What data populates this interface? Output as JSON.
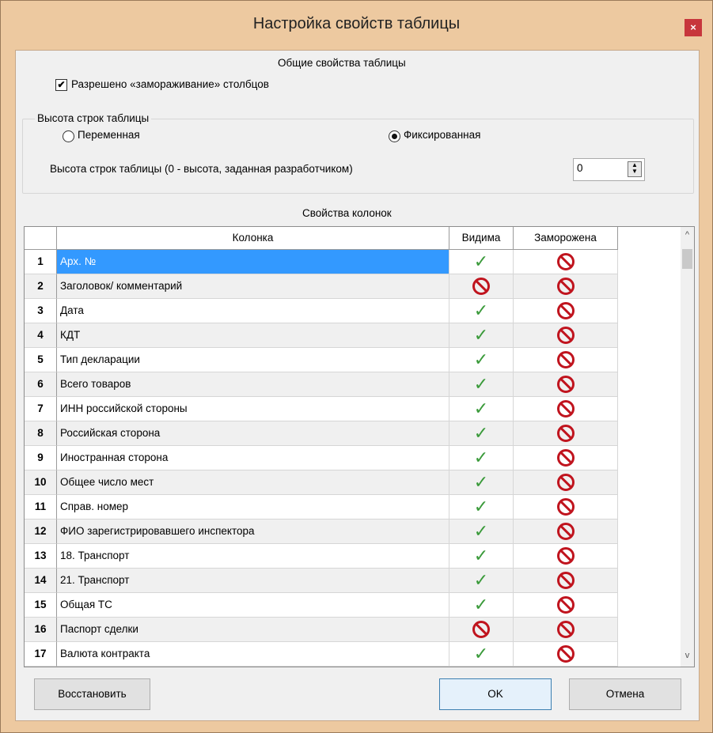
{
  "window": {
    "title": "Настройка свойств таблицы",
    "close_label": "×"
  },
  "general": {
    "heading": "Общие свойства таблицы",
    "freeze_checkbox": {
      "label": "Разрешено «замораживание» столбцов",
      "checked": true,
      "mark": "✔"
    }
  },
  "row_height": {
    "legend": "Высота строк таблицы",
    "variable_label": "Переменная",
    "fixed_label": "Фиксированная",
    "selected": "fixed",
    "height_label": "Высота строк таблицы (0 - высота, заданная разработчиком)",
    "height_value": "0",
    "spin_up": "▲",
    "spin_down": "▼"
  },
  "columns": {
    "heading": "Свойства колонок",
    "headers": {
      "column": "Колонка",
      "visible": "Видима",
      "frozen": "Заморожена"
    },
    "rows": [
      {
        "num": "1",
        "name": "Арх. №",
        "visible": true,
        "frozen": false,
        "selected": true
      },
      {
        "num": "2",
        "name": "Заголовок/ комментарий",
        "visible": false,
        "frozen": false
      },
      {
        "num": "3",
        "name": "Дата",
        "visible": true,
        "frozen": false
      },
      {
        "num": "4",
        "name": "КДТ",
        "visible": true,
        "frozen": false
      },
      {
        "num": "5",
        "name": "Тип декларации",
        "visible": true,
        "frozen": false
      },
      {
        "num": "6",
        "name": "Всего товаров",
        "visible": true,
        "frozen": false
      },
      {
        "num": "7",
        "name": "ИНН российской стороны",
        "visible": true,
        "frozen": false
      },
      {
        "num": "8",
        "name": "Российская сторона",
        "visible": true,
        "frozen": false
      },
      {
        "num": "9",
        "name": "Иностранная сторона",
        "visible": true,
        "frozen": false
      },
      {
        "num": "10",
        "name": "Общее число мест",
        "visible": true,
        "frozen": false
      },
      {
        "num": "11",
        "name": "Справ. номер",
        "visible": true,
        "frozen": false
      },
      {
        "num": "12",
        "name": "ФИО зарегистрировавшего инспектора",
        "visible": true,
        "frozen": false
      },
      {
        "num": "13",
        "name": "18. Транспорт",
        "visible": true,
        "frozen": false
      },
      {
        "num": "14",
        "name": "21. Транспорт",
        "visible": true,
        "frozen": false
      },
      {
        "num": "15",
        "name": "Общая ТС",
        "visible": true,
        "frozen": false
      },
      {
        "num": "16",
        "name": "Паспорт сделки",
        "visible": false,
        "frozen": false
      },
      {
        "num": "17",
        "name": "Валюта контракта",
        "visible": true,
        "frozen": false
      }
    ],
    "check_glyph": "✓",
    "scroll_up": "^",
    "scroll_down": "v"
  },
  "buttons": {
    "restore": "Восстановить",
    "ok": "OK",
    "cancel": "Отмена"
  },
  "colors": {
    "window_frame": "#edc9a0",
    "close": "#c7363c",
    "selection": "#3399ff",
    "check": "#3a9a3a",
    "prohibited": "#c0141e"
  }
}
